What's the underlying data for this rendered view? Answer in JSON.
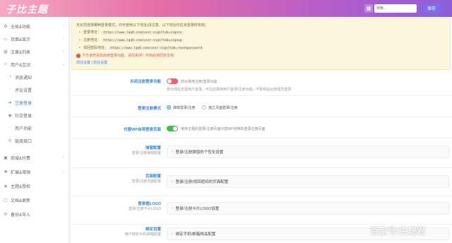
{
  "header": {
    "logo": "子比主题",
    "search_placeholder": "搜索...",
    "save_label": "保存",
    "grid_icon": "grid-icon"
  },
  "sidebar": {
    "items": [
      {
        "label": "全局&功能",
        "icon": "gear-icon",
        "expanded": false
      },
      {
        "label": "页面&显示",
        "icon": "page-icon",
        "expanded": false
      },
      {
        "label": "文章&列表",
        "icon": "article-icon",
        "expanded": false
      },
      {
        "label": "用户&互动",
        "icon": "user-icon",
        "expanded": true
      },
      {
        "label": "消息通知",
        "icon": "bell-icon",
        "sub": true
      },
      {
        "label": "评论设置",
        "icon": "comment-icon",
        "sub": true
      },
      {
        "label": "注册登录",
        "icon": "login-icon",
        "sub": true,
        "active": true
      },
      {
        "label": "社交登录",
        "icon": "social-icon",
        "sub": true
      },
      {
        "label": "用户功能",
        "icon": "user-func-icon",
        "sub": true
      },
      {
        "label": "链接接口",
        "icon": "link-icon",
        "sub": true
      },
      {
        "label": "商城&付费",
        "icon": "shop-icon",
        "expanded": false
      },
      {
        "label": "扩展&增强",
        "icon": "extend-icon",
        "expanded": false
      },
      {
        "label": "主题&授权",
        "icon": "theme-icon",
        "expanded": false
      },
      {
        "label": "文档&更新",
        "icon": "doc-icon",
        "expanded": false
      },
      {
        "label": "备份&导入",
        "icon": "backup-icon",
        "expanded": false
      }
    ],
    "accent": "#3a86d8"
  },
  "notice": {
    "intro": "无论您选择哪种登录模式，均可使用以下地址(请注意，以下地址仅在未登录时有效)",
    "lines": [
      {
        "label": "登录地址：",
        "url": "https://www.lqq9.com/user-sign?tab=signin"
      },
      {
        "label": "注册地址：",
        "url": "https://www.lqq9.com/user-sign?tab=signup"
      },
      {
        "label": "找回密码地址：",
        "url": "https://www.lqq9.com/user-sign?tab=resetpassword"
      }
    ],
    "warning": "下方该开关仅启用登录功能，请勿关闭！开启后将同步生效",
    "links": [
      "前往设置",
      "前往设置"
    ]
  },
  "rows": {
    "disable_login": {
      "label": "关闭注册登录功能",
      "toggle_text": "前台禁用注册/登录功能",
      "desc": "部分网站无需用户登录，可在此禁用用户登录/注册功能，不影响后台管理员登录",
      "enabled": false
    },
    "login_mode": {
      "label": "登录注册模式",
      "options": [
        "弹窗登录/注册",
        "独立页面登录/注册"
      ],
      "selected": 0
    },
    "replace_wp": {
      "label": "代替WP自带登录页面",
      "toggle_text": "使用主题的登录/注册页面代替WP自带的登录注册页面",
      "enabled": true
    },
    "popup_config": {
      "label": "弹窗配置",
      "sublabel": "登录/注册弹窗配置",
      "panel": "登录/注册弹窗的个性化设置"
    },
    "page_config": {
      "label": "页面配置",
      "sublabel": "登录/注册页面配置",
      "panel": "登录/注册/找回密码的页面配置"
    },
    "logo_config": {
      "label": "登录框LOGO",
      "sublabel": "登录/注册卡片LOGO",
      "panel": "登录/注册卡片LOGO设置"
    },
    "bind_config": {
      "label": "绑定设置",
      "sublabel": "用户绑定手机/邮箱配置",
      "panel": "绑定手机/邮箱相关配置"
    }
  },
  "watermark": "百家号/主题君"
}
